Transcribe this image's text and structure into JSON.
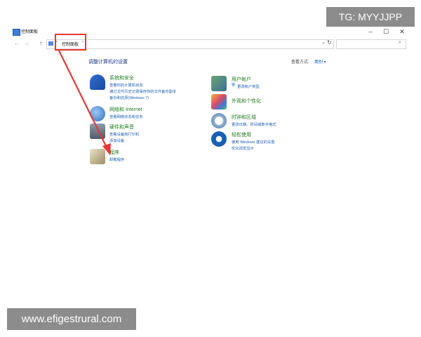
{
  "window": {
    "title": "控制面板",
    "controls": {
      "minimize": "–",
      "maximize": "☐",
      "close": "✕"
    }
  },
  "address_bar": {
    "back": "←",
    "forward": "→",
    "up": "↑",
    "breadcrumb": "控制面板",
    "separator": "›",
    "dropdown": "⌄",
    "refresh": "↻",
    "search_icon": "⌕"
  },
  "main": {
    "heading": "调整计算机的设置",
    "view_by_label": "查看方式:",
    "view_by_value": "类别 ▾"
  },
  "categories_left": [
    {
      "title": "系统和安全",
      "links": [
        "查看你的计算机状态",
        "通过文件历史记录保存你的文件备份副本",
        "备份和还原(Windows 7)"
      ],
      "icon": "shield-flag-icon"
    },
    {
      "title": "网络和 Internet",
      "links": [
        "查看网络状态和任务"
      ],
      "icon": "network-globe-icon"
    },
    {
      "title": "硬件和声音",
      "links": [
        "查看设备和打印机",
        "添加设备"
      ],
      "icon": "printer-speaker-icon"
    },
    {
      "title": "程序",
      "links": [
        "卸载程序"
      ],
      "icon": "programs-box-icon"
    }
  ],
  "categories_right": [
    {
      "title": "用户帐户",
      "links": [
        "更改帐户类型"
      ],
      "icon": "users-icon",
      "shield_links": true
    },
    {
      "title": "外观和个性化",
      "links": [],
      "icon": "appearance-monitor-icon"
    },
    {
      "title": "时钟和区域",
      "links": [
        "更改日期、时间或数字格式"
      ],
      "icon": "clock-globe-icon"
    },
    {
      "title": "轻松使用",
      "links": [
        "使用 Windows 建议的设置",
        "优化视觉显示"
      ],
      "icon": "ease-of-access-icon"
    }
  ],
  "watermarks": {
    "top_right": "TG: MYYJJPP",
    "bottom_left": "www.efigestrural.com"
  },
  "colors": {
    "highlight": "#e53935",
    "link": "#1a5fb4",
    "category_title": "#1f7a1f"
  }
}
